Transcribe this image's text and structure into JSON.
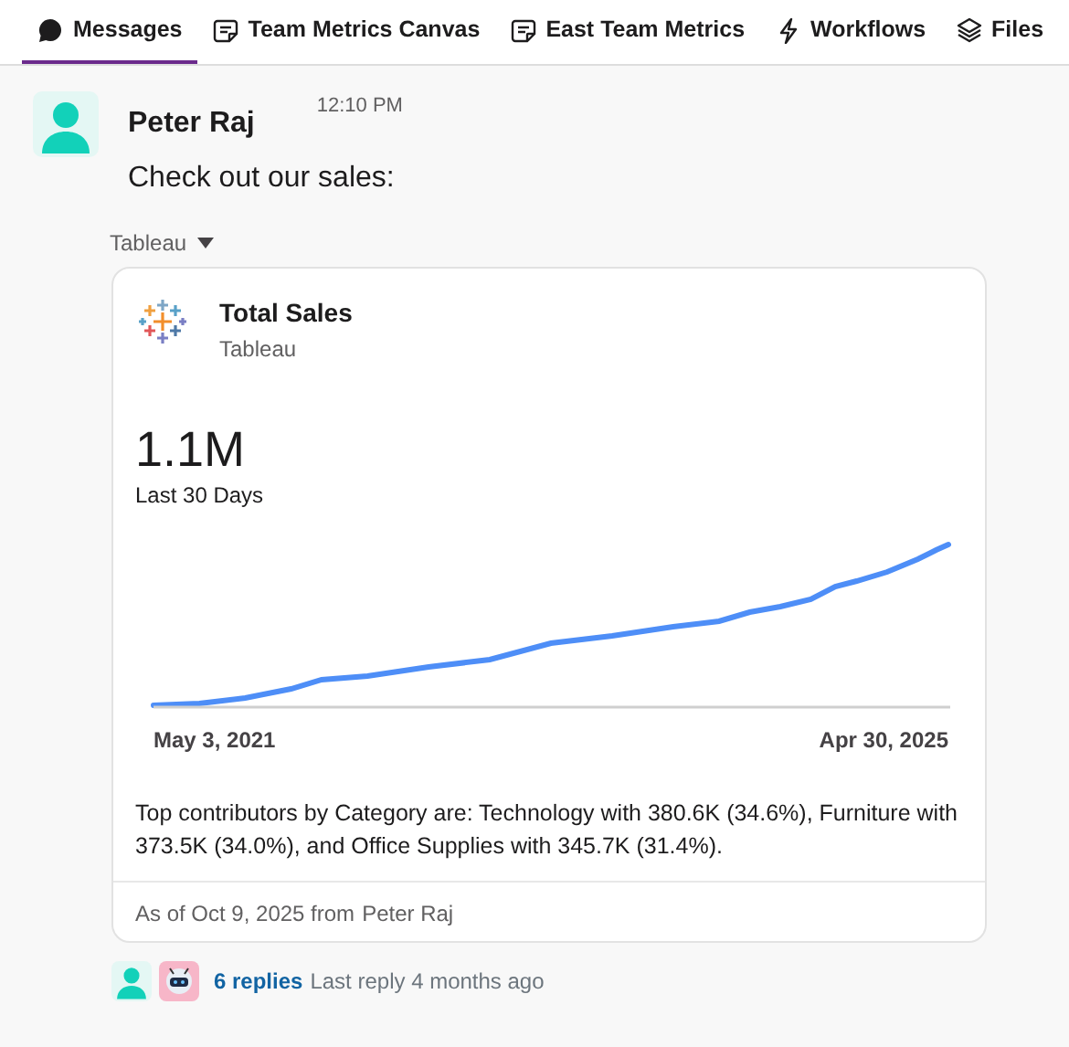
{
  "tabs": [
    {
      "label": "Messages",
      "kind": "chat",
      "selected": true
    },
    {
      "label": "Team Metrics Canvas",
      "kind": "canvas",
      "selected": false
    },
    {
      "label": "East Team Metrics",
      "kind": "canvas",
      "selected": false
    },
    {
      "label": "Workflows",
      "kind": "bolt",
      "selected": false
    },
    {
      "label": "Files",
      "kind": "layers",
      "selected": false
    }
  ],
  "message": {
    "author": "Peter Raj",
    "time": "12:10 PM",
    "text": "Check out our sales:",
    "attachment": {
      "source": "Tableau",
      "card": {
        "title": "Total Sales",
        "subtitle": "Tableau",
        "metric": "1.1M",
        "period": "Last 30 Days",
        "chart": {
          "start_label": "May 3, 2021",
          "end_label": "Apr 30, 2025"
        },
        "summary": "Top contributors by Category are: Technology with 380.6K (34.6%), Furniture with 373.5K (34.0%), and Office Supplies with 345.7K (31.4%).",
        "footer": {
          "as_of": "As of Oct 9, 2025 from",
          "author": "Peter Raj"
        }
      }
    }
  },
  "thread": {
    "replies": "6 replies",
    "last_reply": "Last reply 4 months ago"
  }
}
